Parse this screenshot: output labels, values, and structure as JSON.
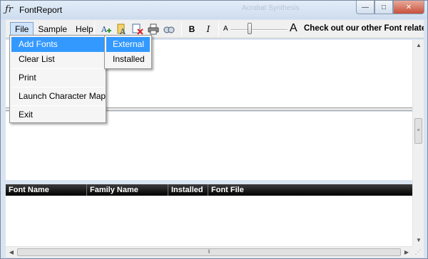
{
  "window": {
    "title": "FontReport",
    "background_title": "Acrobat Synthesis",
    "controls": {
      "minimize": "—",
      "maximize": "□",
      "close": "✕"
    }
  },
  "menubar": {
    "items": [
      "File",
      "Sample",
      "Help"
    ],
    "active": "File"
  },
  "toolbar": {
    "icons": [
      "add-font-icon",
      "font-info-icon",
      "remove-font-icon",
      "print-icon",
      "character-map-icon"
    ],
    "bold_label": "B",
    "italic_label": "I",
    "size_small_label": "A",
    "size_large_label": "A",
    "font_size_level": 0.45,
    "promo_text": "Check out our other Font related tools"
  },
  "file_menu": {
    "items": [
      {
        "label": "Add Fonts",
        "highlighted": true,
        "has_submenu": true
      },
      {
        "label": "Clear List"
      },
      {
        "label": "Print"
      },
      {
        "label": "Launch Character Map"
      },
      {
        "label": "Exit"
      }
    ]
  },
  "add_fonts_submenu": {
    "items": [
      {
        "label": "External",
        "highlighted": true
      },
      {
        "label": "Installed"
      }
    ]
  },
  "table": {
    "columns": [
      "Font Name",
      "Family Name",
      "Installed",
      "Font File"
    ],
    "rows": []
  },
  "colors": {
    "highlight": "#3399ff",
    "header_bg": "#000000",
    "chrome": "#d9e4f1"
  }
}
